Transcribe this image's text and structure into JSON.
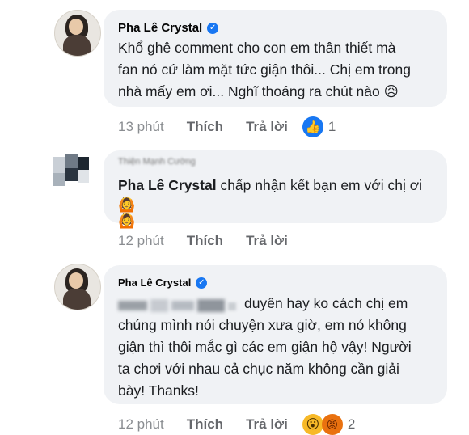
{
  "comments": [
    {
      "author": "Pha Lê Crystal",
      "verified": true,
      "text_lines": [
        "Khổ ghê comment cho con em thân thiết mà",
        "fan nó cứ làm mặt tức giận thôi... Chị em trong",
        "nhà mấy em ơi... Nghĩ thoáng ra chút nào"
      ],
      "emoji": "😥",
      "time": "13 phút",
      "like_label": "Thích",
      "reply_label": "Trả lời",
      "reaction_icons": [
        "like-icon"
      ],
      "reaction_count": "1"
    },
    {
      "author_obscured": "Thiện Mạnh Cường",
      "mention": "Pha Lê Crystal",
      "text": "chấp nhận kết bạn em với chị ơi",
      "emojis": "🙆🙆",
      "time": "12 phút",
      "like_label": "Thích",
      "reply_label": "Trả lời"
    },
    {
      "author": "Pha Lê Crystal",
      "verified": true,
      "text_lines": [
        "duyên hay ko cách chị em",
        "chúng mình nói chuyện xưa giờ, em nó không",
        "giận thì thôi mắc gì các em giận hộ vậy! Người",
        "ta chơi với nhau cả chục năm không cần giải",
        "bày! Thanks!"
      ],
      "time": "12 phút",
      "like_label": "Thích",
      "reply_label": "Trả lời",
      "reaction_icons": [
        "wow-icon",
        "angry-icon"
      ],
      "reaction_count": "2"
    }
  ],
  "colors": {
    "bubble": "#f0f2f5",
    "meta_text": "#65676b",
    "verified": "#1877f2",
    "like": "#1877f2"
  }
}
